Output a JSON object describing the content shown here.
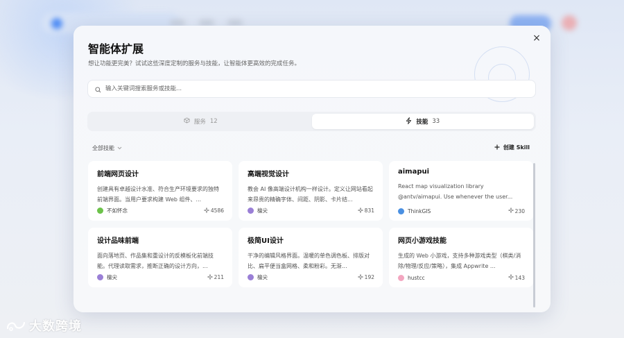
{
  "modal": {
    "title": "智能体扩展",
    "subtitle": "想让功能更完美？试试这些深度定制的服务与技能，让智能体更高效的完成任务。",
    "close_icon": "×"
  },
  "search": {
    "placeholder": "输入关键词搜索服务或技能..."
  },
  "tabs": [
    {
      "label": "服务",
      "count": "12",
      "icon": "box-icon",
      "active": false
    },
    {
      "label": "技能",
      "count": "33",
      "icon": "lightning-icon",
      "active": true
    }
  ],
  "filter": {
    "label": "全部技能"
  },
  "create": {
    "label": "创建 Skill"
  },
  "cards": [
    {
      "title": "前端网页设计",
      "desc": "创建具有卓越设计水准、符合生产环境要求的独特前端界面。当用户要求构建 Web 组件、...",
      "author": "不如怀念",
      "stars": "4586",
      "avatar_color": "#6cc24a"
    },
    {
      "title": "高端视觉设计",
      "desc": "教会 AI 像高端设计机构一样设计。定义让网站看起来昂贵的精确字体、间距、阴影、卡片结...",
      "author": "檀尖",
      "stars": "831",
      "avatar_color": "#9a7fd6"
    },
    {
      "title": "aimapui",
      "desc": "React map visualization library @antv/aimapui. Use whenever the user...",
      "author": "ThinkGIS",
      "stars": "230",
      "avatar_color": "#4a90e2"
    },
    {
      "title": "设计品味前端",
      "desc": "面向落地页、作品集和重设计的反模板化前端技能。代理读取需求，推断正确的设计方向，...",
      "author": "檀尖",
      "stars": "211",
      "avatar_color": "#9a7fd6"
    },
    {
      "title": "极简UI设计",
      "desc": "干净的编辑风格界面。温暖的单色调色板、排版对比、扁平便当盒网格、柔和粉彩。无渐...",
      "author": "檀尖",
      "stars": "192",
      "avatar_color": "#9a7fd6"
    },
    {
      "title": "网页小游戏技能",
      "desc": "生成的 Web 小游戏，支持多种游戏类型（棋类/消除/物理/反应/策略），集成 Appwrite ...",
      "author": "hustcc",
      "stars": "143",
      "avatar_color": "#f3a6c0"
    }
  ],
  "watermark": {
    "text": "大数跨境"
  }
}
